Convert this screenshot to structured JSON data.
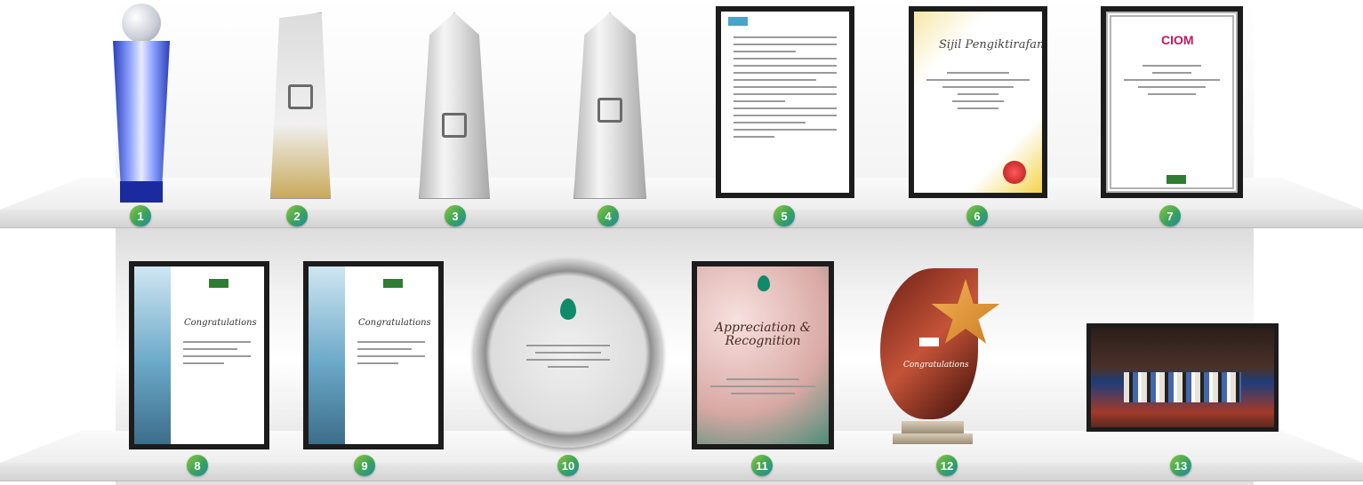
{
  "awards": [
    {
      "number": "1",
      "name": "globe-trophy"
    },
    {
      "number": "2",
      "name": "crystal-tower-trophy"
    },
    {
      "number": "3",
      "name": "crystal-spike-trophy"
    },
    {
      "number": "4",
      "name": "crystal-spike-trophy-2"
    },
    {
      "number": "5",
      "name": "framed-letter"
    },
    {
      "number": "6",
      "name": "framed-certificate"
    },
    {
      "number": "7",
      "name": "framed-award-certificate"
    },
    {
      "number": "8",
      "name": "framed-congratulations-certificate"
    },
    {
      "number": "9",
      "name": "framed-congratulations-certificate-2"
    },
    {
      "number": "10",
      "name": "commemorative-plate"
    },
    {
      "number": "11",
      "name": "appreciation-recognition-frame"
    },
    {
      "number": "12",
      "name": "star-flame-trophy"
    },
    {
      "number": "13",
      "name": "award-ceremony-photo"
    }
  ],
  "certificate6": {
    "title": "Sijil Pengiktirafan"
  },
  "certificate7": {
    "title": "CIOM"
  },
  "certificate8": {
    "title": "Congratulations"
  },
  "certificate9": {
    "title": "Congratulations"
  },
  "plaque11": {
    "title": "Appreciation & Recognition"
  },
  "trophy12": {
    "title": "Congratulations"
  }
}
